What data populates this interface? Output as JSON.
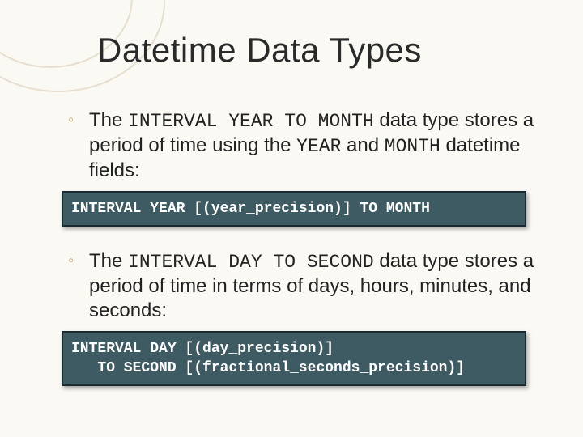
{
  "title": "Datetime Data Types",
  "bullets": [
    {
      "pre": "The ",
      "code1": "INTERVAL YEAR TO MONTH",
      "mid1": " data type stores a period of time using the ",
      "code2": "YEAR",
      "mid2": " and ",
      "code3": "MONTH",
      "post": " datetime fields:"
    },
    {
      "pre": "The ",
      "code1": "INTERVAL DAY TO SECOND",
      "mid1": " data type stores a period of time in terms of days, hours, minutes, and seconds:",
      "code2": "",
      "mid2": "",
      "code3": "",
      "post": ""
    }
  ],
  "codeboxes": [
    "INTERVAL YEAR [(year_precision)] TO MONTH",
    "INTERVAL DAY [(day_precision)]\n   TO SECOND [(fractional_seconds_precision)]"
  ]
}
